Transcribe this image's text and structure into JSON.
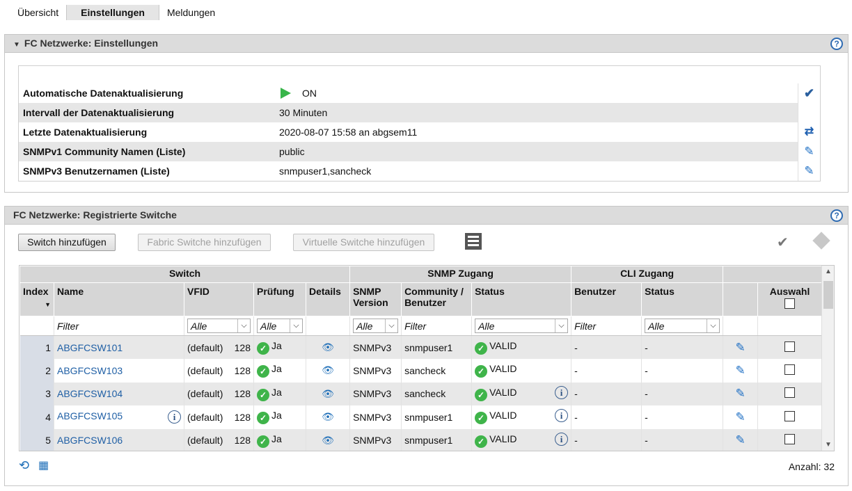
{
  "tabs": [
    {
      "label": "Übersicht"
    },
    {
      "label": "Einstellungen"
    },
    {
      "label": "Meldungen"
    }
  ],
  "settings_panel": {
    "title": "FC Netzwerke: Einstellungen",
    "help": "?",
    "rows": [
      {
        "key": "Automatische Datenaktualisierung",
        "value": "ON"
      },
      {
        "key": "Intervall der Datenaktualisierung",
        "value": "30 Minuten"
      },
      {
        "key": "Letzte Datenaktualisierung",
        "value": "2020-08-07 15:58 an abgsem11"
      },
      {
        "key": "SNMPv1 Community Namen (Liste)",
        "value": "public"
      },
      {
        "key": "SNMPv3 Benutzernamen (Liste)",
        "value": "snmpuser1,sancheck"
      }
    ]
  },
  "switch_panel": {
    "title": "FC Netzwerke: Registrierte Switche",
    "help": "?",
    "buttons": {
      "add": "Switch hinzufügen",
      "add_fabric": "Fabric Switche hinzufügen",
      "add_virtual": "Virtuelle Switche hinzufügen"
    },
    "groups": {
      "switch": "Switch",
      "snmp": "SNMP Zugang",
      "cli": "CLI Zugang"
    },
    "columns": {
      "index": "Index",
      "name": "Name",
      "vfid": "VFID",
      "pruefung": "Prüfung",
      "details": "Details",
      "snmp_version": "SNMP Version",
      "community": "Community / Benutzer",
      "status": "Status",
      "benutzer": "Benutzer",
      "cli_status": "Status",
      "auswahl": "Auswahl"
    },
    "filters": {
      "text": "Filter",
      "all": "Alle"
    },
    "rows": [
      {
        "index": "1",
        "name": "ABGFCSW101",
        "vfid": "(default)",
        "vfid_num": "128",
        "check": "Ja",
        "snmp": "SNMPv3",
        "community": "snmpuser1",
        "status": "VALID",
        "user": "-",
        "cli": "-"
      },
      {
        "index": "2",
        "name": "ABGFCSW103",
        "vfid": "(default)",
        "vfid_num": "128",
        "check": "Ja",
        "snmp": "SNMPv3",
        "community": "sancheck",
        "status": "VALID",
        "user": "-",
        "cli": "-"
      },
      {
        "index": "3",
        "name": "ABGFCSW104",
        "vfid": "(default)",
        "vfid_num": "128",
        "check": "Ja",
        "snmp": "SNMPv3",
        "community": "sancheck",
        "status": "VALID",
        "user": "-",
        "cli": "-"
      },
      {
        "index": "4",
        "name": "ABGFCSW105",
        "vfid": "(default)",
        "vfid_num": "128",
        "check": "Ja",
        "snmp": "SNMPv3",
        "community": "snmpuser1",
        "status": "VALID",
        "user": "-",
        "cli": "-"
      },
      {
        "index": "5",
        "name": "ABGFCSW106",
        "vfid": "(default)",
        "vfid_num": "128",
        "check": "Ja",
        "snmp": "SNMPv3",
        "community": "snmpuser1",
        "status": "VALID",
        "user": "-",
        "cli": "-"
      }
    ],
    "count": "Anzahl: 32"
  }
}
